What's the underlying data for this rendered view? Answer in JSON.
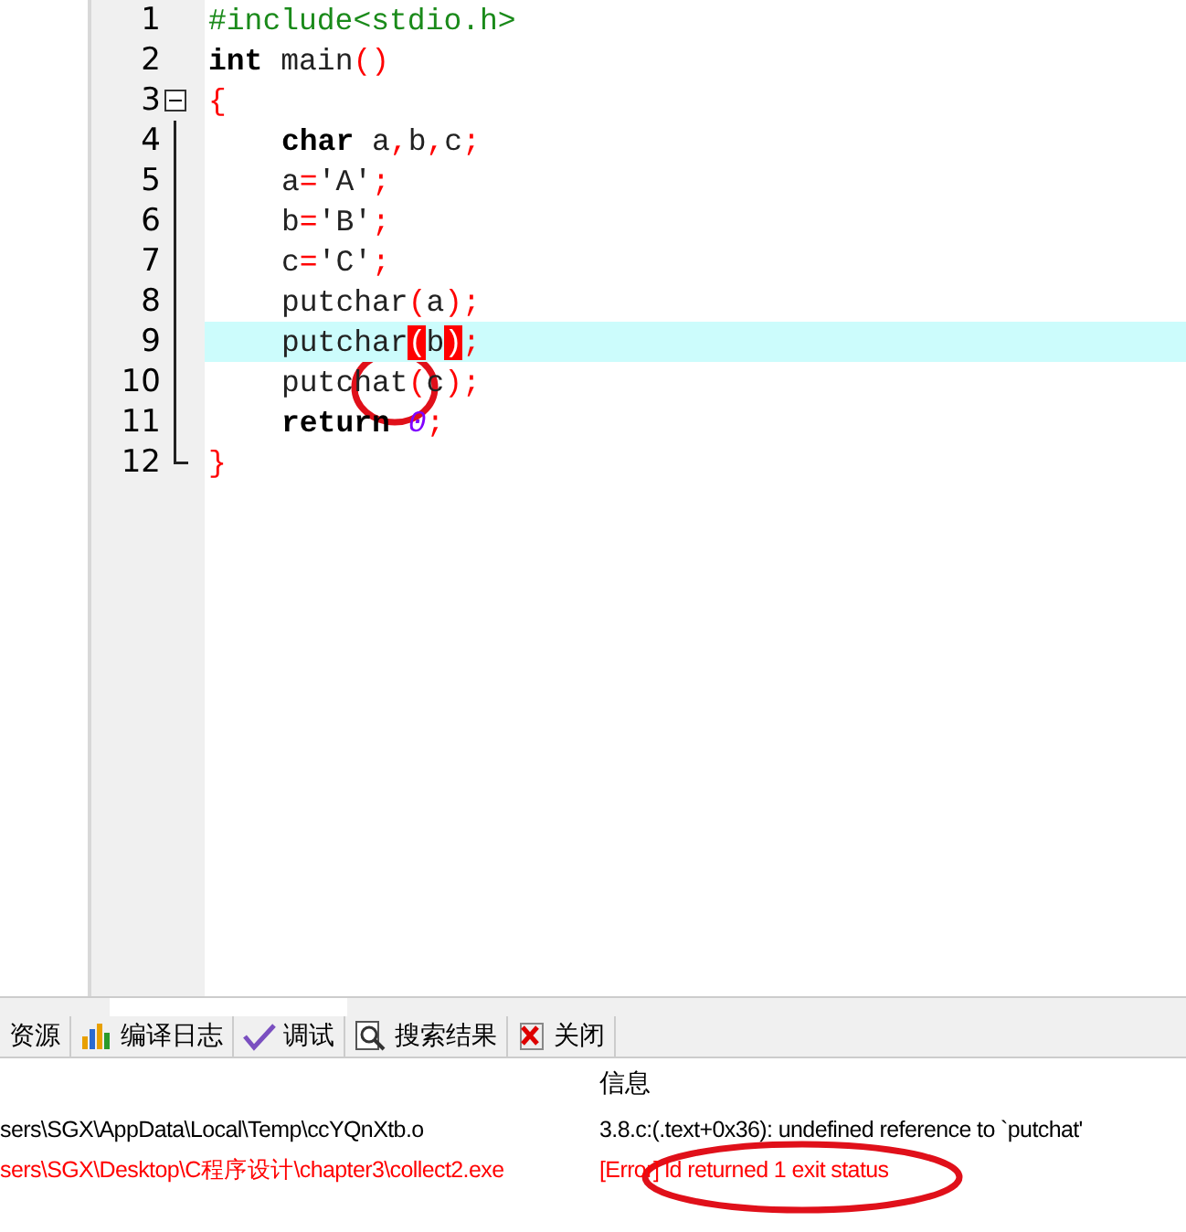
{
  "editor": {
    "lines": [
      {
        "number": "1",
        "current": false,
        "tokens": [
          {
            "kind": "preproc",
            "text": "#include<stdio.h>"
          }
        ]
      },
      {
        "number": "2",
        "current": false,
        "tokens": [
          {
            "kind": "keyword",
            "text": "int"
          },
          {
            "kind": "plain",
            "text": " main"
          },
          {
            "kind": "punct",
            "text": "()"
          }
        ]
      },
      {
        "number": "3",
        "current": false,
        "tokens": [
          {
            "kind": "punct",
            "text": "{"
          }
        ],
        "children": [
          {
            "number": "4",
            "current": false,
            "tokens": [
              {
                "kind": "keyword",
                "text": "char"
              },
              {
                "kind": "plain",
                "text": " a"
              },
              {
                "kind": "punct",
                "text": ","
              },
              {
                "kind": "plain",
                "text": "b"
              },
              {
                "kind": "punct",
                "text": ","
              },
              {
                "kind": "plain",
                "text": "c"
              },
              {
                "kind": "punct",
                "text": ";"
              }
            ]
          },
          {
            "number": "5",
            "current": false,
            "tokens": [
              {
                "kind": "plain",
                "text": "a"
              },
              {
                "kind": "punct",
                "text": "="
              },
              {
                "kind": "plain",
                "text": "'A'"
              },
              {
                "kind": "punct",
                "text": ";"
              }
            ]
          },
          {
            "number": "6",
            "current": false,
            "tokens": [
              {
                "kind": "plain",
                "text": "b"
              },
              {
                "kind": "punct",
                "text": "="
              },
              {
                "kind": "plain",
                "text": "'B'"
              },
              {
                "kind": "punct",
                "text": ";"
              }
            ]
          },
          {
            "number": "7",
            "current": false,
            "tokens": [
              {
                "kind": "plain",
                "text": "c"
              },
              {
                "kind": "punct",
                "text": "="
              },
              {
                "kind": "plain",
                "text": "'C'"
              },
              {
                "kind": "punct",
                "text": ";"
              }
            ]
          },
          {
            "number": "8",
            "current": false,
            "tokens": [
              {
                "kind": "plain",
                "text": "putchar"
              },
              {
                "kind": "punct",
                "text": "("
              },
              {
                "kind": "plain",
                "text": "a"
              },
              {
                "kind": "punct",
                "text": ");"
              }
            ]
          },
          {
            "number": "9",
            "current": true,
            "tokens": [
              {
                "kind": "plain",
                "text": "putchar"
              },
              {
                "kind": "match",
                "text": "("
              },
              {
                "kind": "plain",
                "text": "b"
              },
              {
                "kind": "match",
                "text": ")"
              },
              {
                "kind": "punct",
                "text": ";"
              }
            ]
          },
          {
            "number": "10",
            "current": false,
            "tokens": [
              {
                "kind": "plain",
                "text": "putchat"
              },
              {
                "kind": "punct",
                "text": "("
              },
              {
                "kind": "plain",
                "text": "c"
              },
              {
                "kind": "punct",
                "text": ");"
              }
            ]
          },
          {
            "number": "11",
            "current": false,
            "tokens": [
              {
                "kind": "keyword",
                "text": "return"
              },
              {
                "kind": "number",
                "text": " 0"
              },
              {
                "kind": "punct",
                "text": ";"
              }
            ]
          }
        ]
      },
      {
        "number": "12",
        "current": false,
        "tokens": [
          {
            "kind": "punct",
            "text": "}"
          }
        ]
      }
    ]
  },
  "tabs": [
    {
      "label": "资源",
      "selected": false
    },
    {
      "label": "编译日志",
      "selected": false
    },
    {
      "label": "调试",
      "selected": false
    },
    {
      "label": "搜索结果",
      "selected": false
    },
    {
      "label": "关闭",
      "selected": false
    }
  ],
  "messages": {
    "columns": [
      "信息"
    ],
    "rows": [
      {
        "kind": "plain",
        "file": "sers\\SGX\\AppData\\Local\\Temp\\ccYQnXtb.o",
        "message": "3.8.c:(.text+0x36): undefined reference to `putchat'"
      },
      {
        "kind": "error",
        "file": "sers\\SGX\\Desktop\\C程序设计\\chapter3\\collect2.exe",
        "message": "[Error] ld returned 1 exit status"
      }
    ]
  }
}
